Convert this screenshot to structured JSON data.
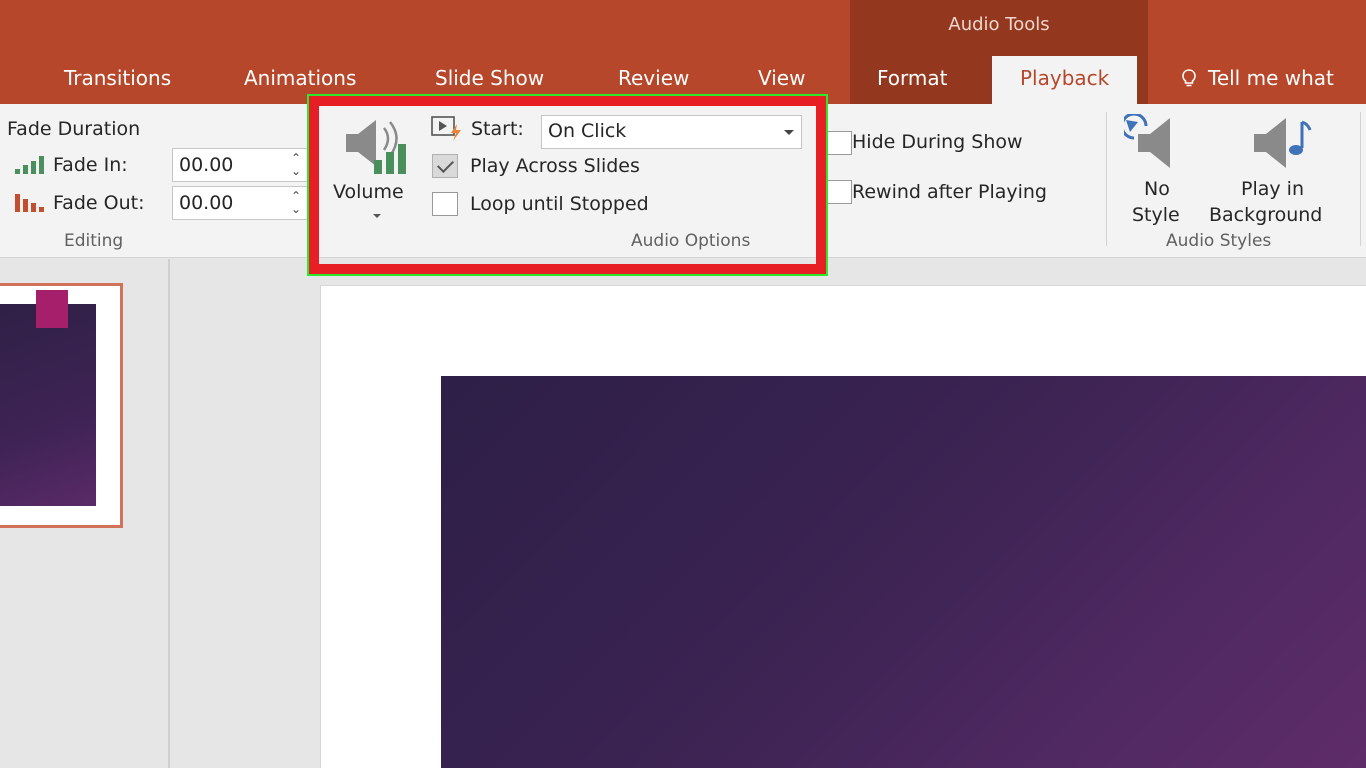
{
  "contextual": {
    "title": "Audio Tools"
  },
  "tabs": [
    {
      "label": "Transitions",
      "active": false
    },
    {
      "label": "Animations",
      "active": false
    },
    {
      "label": "Slide Show",
      "active": false
    },
    {
      "label": "Review",
      "active": false
    },
    {
      "label": "View",
      "active": false
    },
    {
      "label": "Format",
      "active": false
    },
    {
      "label": "Playback",
      "active": true
    }
  ],
  "tell_me": {
    "label": "Tell me what",
    "icon": "lightbulb-icon"
  },
  "editing": {
    "fade_duration_label": "Fade Duration",
    "fade_in_label": "Fade In:",
    "fade_in_value": "00.00",
    "fade_out_label": "Fade Out:",
    "fade_out_value": "00.00",
    "group_label": "Editing"
  },
  "audio_options": {
    "volume_label": "Volume",
    "start_label": "Start:",
    "start_value": "On Click",
    "play_across_slides_label": "Play Across Slides",
    "play_across_slides_checked": true,
    "loop_label": "Loop until Stopped",
    "loop_checked": false,
    "hide_during_show_label": "Hide During Show",
    "hide_during_show_checked": false,
    "rewind_label": "Rewind after Playing",
    "rewind_checked": false,
    "group_label": "Audio Options"
  },
  "audio_styles": {
    "no_style_line1": "No",
    "no_style_line2": "Style",
    "play_bg_line1": "Play in",
    "play_bg_line2": "Background",
    "group_label": "Audio Styles"
  },
  "colors": {
    "accent": "#b7472a",
    "contextual_tab": "#93381f",
    "highlight_box": "#e81e25",
    "slide_background": "#3b2352"
  }
}
